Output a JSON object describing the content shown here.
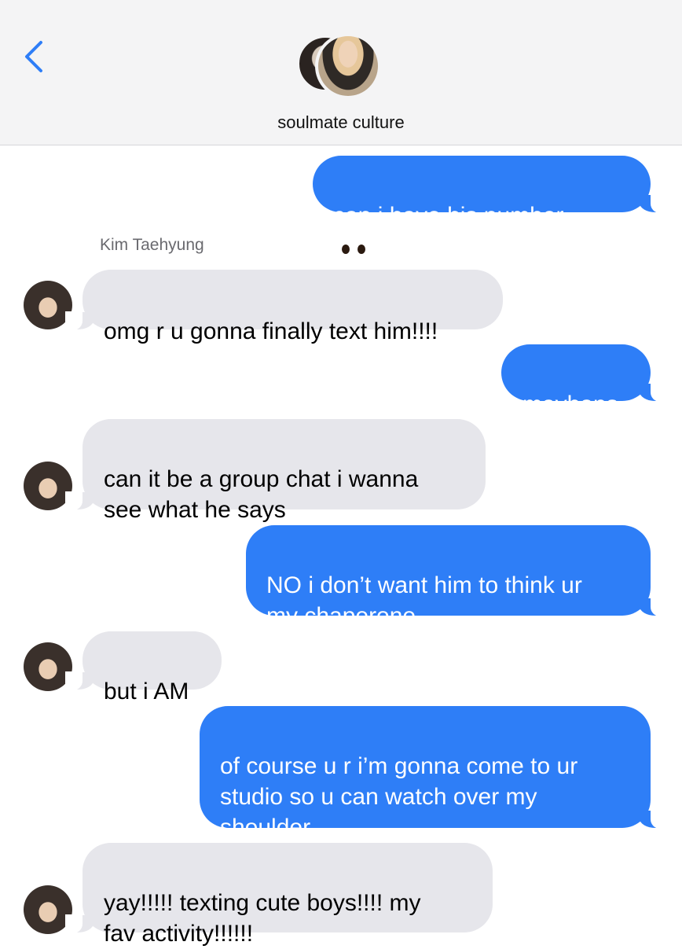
{
  "header": {
    "title": "soulmate culture",
    "back_icon": "chevron-left-icon",
    "accent": "#2e7ef7"
  },
  "sender_name": "Kim Taehyung",
  "messages": [
    {
      "from": "me",
      "text": "can i have his number",
      "emoji": "eyes-icon"
    },
    {
      "from": "them",
      "text": "omg r u gonna finally text him!!!!"
    },
    {
      "from": "me",
      "text": "mayhaps"
    },
    {
      "from": "them",
      "text": "can it be a group chat i wanna\nsee what he says"
    },
    {
      "from": "me",
      "text": "NO i don’t want him to think ur\nmy chaperone"
    },
    {
      "from": "them",
      "text": "but i AM"
    },
    {
      "from": "me",
      "text": "of course u r i’m gonna come to ur\nstudio so u can watch over my\nshoulder"
    },
    {
      "from": "them",
      "text": "yay!!!!! texting cute boys!!!! my\nfav activity!!!!!!"
    }
  ],
  "colors": {
    "outgoing": "#2e7ef7",
    "incoming": "#e6e6eb"
  }
}
